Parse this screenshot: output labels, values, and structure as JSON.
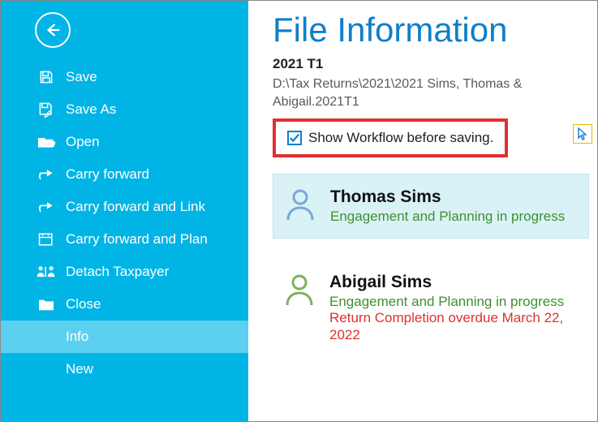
{
  "sidebar": {
    "items": [
      {
        "label": "Save"
      },
      {
        "label": "Save As"
      },
      {
        "label": "Open"
      },
      {
        "label": "Carry forward"
      },
      {
        "label": "Carry forward and Link"
      },
      {
        "label": "Carry forward and Plan"
      },
      {
        "label": "Detach Taxpayer"
      },
      {
        "label": "Close"
      },
      {
        "label": "Info"
      },
      {
        "label": "New"
      }
    ]
  },
  "main": {
    "title": "File Information",
    "file_year": "2021 T1",
    "file_path": "D:\\Tax Returns\\2021\\2021 Sims, Thomas & Abigail.2021T1",
    "checkbox_label": "Show Workflow before saving.",
    "checkbox_checked": true
  },
  "people": [
    {
      "name": "Thomas Sims",
      "status": "Engagement and Planning in progress",
      "selected": true,
      "avatar_color": "#7aa7d9",
      "warn": ""
    },
    {
      "name": "Abigail Sims",
      "status": "Engagement and Planning in progress",
      "selected": false,
      "avatar_color": "#7fb060",
      "warn": "Return Completion overdue March 22, 2022"
    }
  ]
}
